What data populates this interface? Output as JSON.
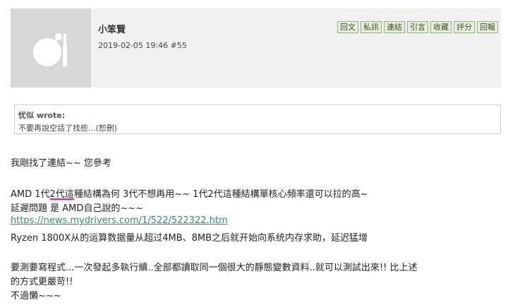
{
  "post": {
    "username": "小笨賢",
    "date": "2019-02-05 19:46",
    "number": "#55",
    "avatar_icon": "default-avatar-icon",
    "actions": [
      "回文",
      "私訊",
      "連結",
      "引言",
      "收藏",
      "評分",
      "回報"
    ]
  },
  "quote": {
    "author": "忧似 wrote:",
    "text": "不要再說空話了找些...(恕刪)"
  },
  "body": {
    "line1": "我剛找了連結~~ 您參考",
    "line2_pre": "AMD 1代",
    "line2_mark": "2代這",
    "line2_post": "種結構為何 3代不想再用~~ 1代2代這種結構單核心頻率還可以拉的高~",
    "line3": "延遲問題  是 AMD自己說的~~~",
    "link": "https://news.mydrivers.com/1/522/522322.htm",
    "line5": "Ryzen 1800X从的运算数据量从超过4MB、8MB之后就开始向系统内存求助，延迟猛增",
    "line6": "要測要寫程式...一次發起多執行續..全部都讀取同一個很大的靜態變數資料..就可以測試出來!! 比上述",
    "line7": "的方式更嚴苛!!",
    "line8": "不過懶~~~"
  },
  "colors": {
    "header_bg": "#f1f1f1",
    "button_bg": "#e9efdf",
    "button_border": "#97ac82",
    "link": "#2f8f6e",
    "highlight_underline": "#d11fd1"
  }
}
